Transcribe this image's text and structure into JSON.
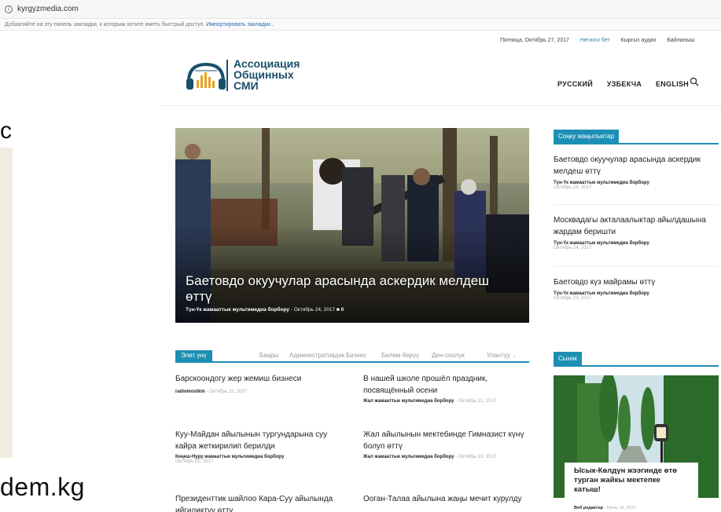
{
  "browser": {
    "url": "kyrgyzmedia.com",
    "bookmarks_hint": "Добавляйте на эту панель закладки, к которым хотите иметь быстрый доступ.",
    "bookmarks_import": "Импортировать закладки..."
  },
  "overlay": {
    "left_letter": "c",
    "left_domain": "dem.kg"
  },
  "topbar": {
    "date": "Пятница, Октябрь 27, 2017",
    "link1": "Негизги бет",
    "link2": "Кыргыз аудио",
    "link3": "Байланыш"
  },
  "logo": {
    "line1": "Ассоциация",
    "line2": "Общинных",
    "line3": "СМИ"
  },
  "nav": {
    "lang_ru": "РУССКИЙ",
    "lang_uz": "УЗБЕКЧА",
    "lang_en": "ENGLISH"
  },
  "hero": {
    "title": "Баетовдо окуучулар арасында аскердик мелдеш өттү",
    "author": "Түн-Үк жамааттык мультимедиа борбору",
    "date": "Октябрь 24, 2017",
    "comments": "0"
  },
  "latest": {
    "heading": "Соңку жаңылыктар",
    "items": [
      {
        "title": "Баетовдо окуучулар арасында аскердик мелдеш өттү",
        "author": "Түн-Үк жамааттык мультимедиа борбору",
        "date": "Октябрь 24, 2017"
      },
      {
        "title": "Москвадагы акталаалыктар айылдашына жардам беришти",
        "author": "Түн-Үк жамааттык мультимедиа борбору",
        "date": "Октябрь 24, 2017"
      },
      {
        "title": "Баетовдо күз майрамы өттү",
        "author": "Түн-Үк жамааттык мультимедиа борбору",
        "date": "Октябрь 23, 2017"
      }
    ]
  },
  "tabs": {
    "items": [
      "Элет үнү",
      "Баары",
      "Административдик",
      "Бизнес",
      "Билим берүү",
      "Ден-соолук",
      "Улантуу"
    ]
  },
  "articles": [
    {
      "title": "Барскоондогу жер жемиш бизнеси",
      "author": "radiomostkm",
      "date": "Октябрь 23, 2017"
    },
    {
      "title": "В нашей школе прошёл праздник, посвящённый осени",
      "author": "Жал жамааттык мультимедиа борбору",
      "date": "Октябрь 21, 2017"
    },
    {
      "title": "Куу-Майдан айылынын тургундарына суу кайра жеткирилип берилди",
      "author": "Кеңеш-Нуру жамааттык мультимедиа борбору",
      "date": "Октябрь 21, 2017"
    },
    {
      "title": "Жал айылынын мектебинде Гимназист күнү болуп өттү",
      "author": "Жал жамааттык мультимедиа борбору",
      "date": "Октябрь 19, 2017"
    },
    {
      "title": "Президенттик шайлоо Кара-Суу айылында ийгиликтүү өттү",
      "author": "",
      "date": ""
    },
    {
      "title": "Ооган-Талаа айылына жаңы мечит курулду",
      "author": "",
      "date": ""
    }
  ],
  "review": {
    "heading": "Сынак",
    "title": "Ысык-Көлдүн жээгинде өтө турган жайкы мектепке катыш!",
    "author": "Веб редактор",
    "date": "Июнь 19, 2017"
  },
  "colors": {
    "accent": "#1e8fb4",
    "brand": "#1a4f6a"
  }
}
